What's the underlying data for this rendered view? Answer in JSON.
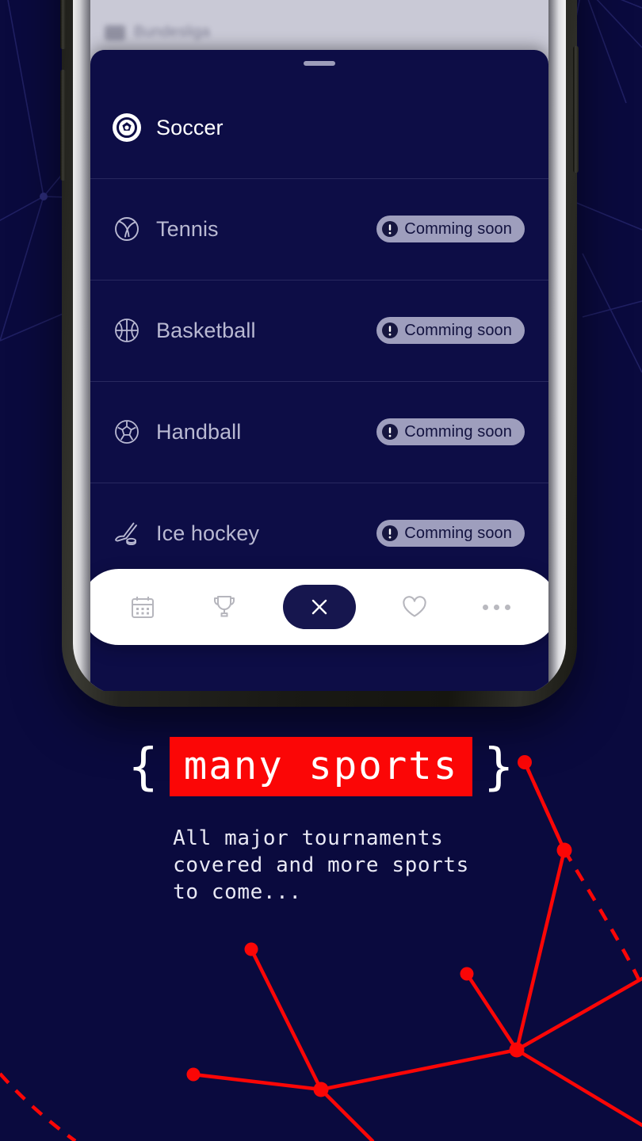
{
  "background": {
    "color": "#0a0a3e",
    "accent_red": "#fb0606",
    "constellation_line_color": "#24246a"
  },
  "phone": {
    "frame_color": "#1a1a14",
    "app_chrome": {
      "label": "Bundesliga",
      "thumb_icon": "league-badge-icon"
    },
    "sheet": {
      "background": "#0d0d46",
      "grabber_name": "sheet-drag-handle"
    },
    "sports": [
      {
        "name": "Soccer",
        "icon": "soccer-ball-icon",
        "active": true,
        "badge": null
      },
      {
        "name": "Tennis",
        "icon": "tennis-ball-icon",
        "active": false,
        "badge": "Comming soon"
      },
      {
        "name": "Basketball",
        "icon": "basketball-icon",
        "active": false,
        "badge": "Comming soon"
      },
      {
        "name": "Handball",
        "icon": "handball-icon",
        "active": false,
        "badge": "Comming soon"
      },
      {
        "name": "Ice hockey",
        "icon": "hockey-stick-icon",
        "active": false,
        "badge": "Comming soon"
      }
    ],
    "badge_icon": "exclamation-circle-icon",
    "badge_bg": "#9e9ebd",
    "badge_text_color": "#12123f",
    "navbar": [
      {
        "icon": "calendar-icon",
        "label": "Calendar"
      },
      {
        "icon": "trophy-icon",
        "label": "Tournaments"
      },
      {
        "icon": "close-icon",
        "label": "Close"
      },
      {
        "icon": "heart-icon",
        "label": "Favorites"
      },
      {
        "icon": "more-dots-icon",
        "label": "More"
      }
    ]
  },
  "copy": {
    "brace_open": "{",
    "brace_close": "}",
    "headline": "many sports",
    "headline_bg": "#fb0606",
    "subcopy": "All major tournaments\ncovered and more sports\nto come..."
  }
}
